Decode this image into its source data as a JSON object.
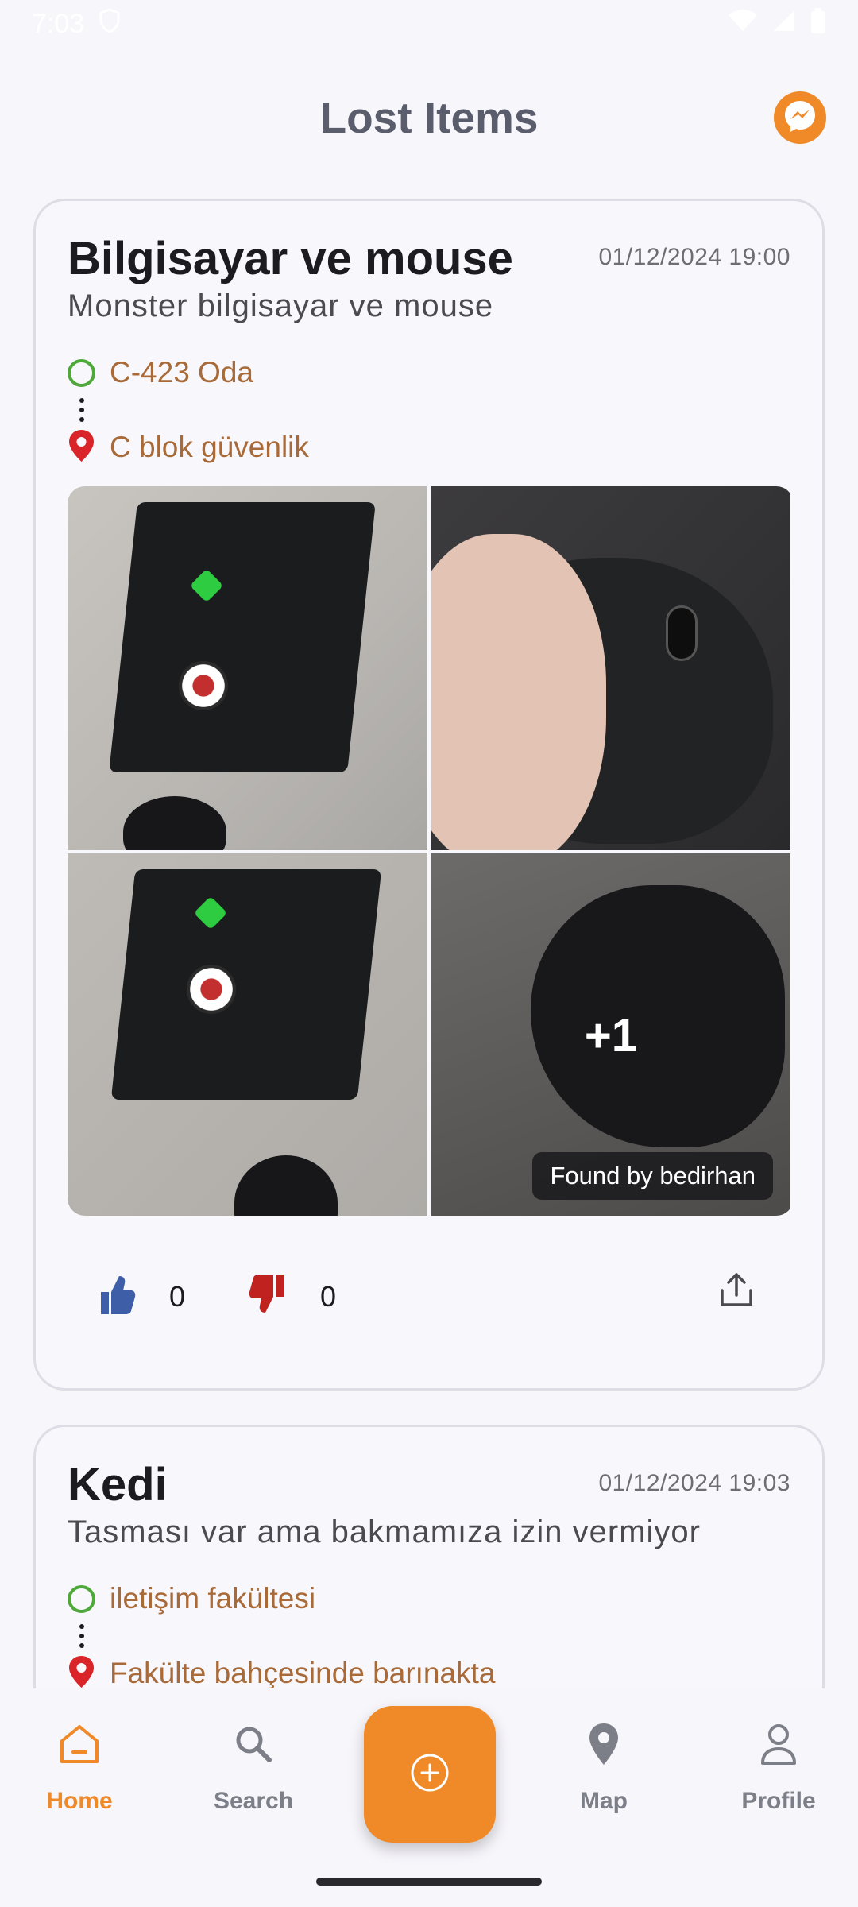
{
  "status_bar": {
    "time": "7:03"
  },
  "header": {
    "title": "Lost Items",
    "messenger_icon": "messenger-icon"
  },
  "colors": {
    "accent": "#f08a29",
    "route_text": "#a86a38",
    "origin": "#4ea83a",
    "destination": "#d9252a",
    "like": "#3f5ea8",
    "dislike": "#c0231f"
  },
  "items": [
    {
      "title": "Bilgisayar ve mouse",
      "date": "01/12/2024 19:00",
      "description": "Monster bilgisayar ve mouse",
      "from": "C-423 Oda",
      "to": "C blok güvenlik",
      "extra_photos": "+1",
      "found_by": "Found by bedirhan",
      "likes": "0",
      "dislikes": "0"
    },
    {
      "title": "Kedi",
      "date": "01/12/2024 19:03",
      "description": "Tasması var ama bakmamıza izin vermiyor",
      "from": "iletişim fakültesi",
      "to": "Fakülte bahçesinde barınakta"
    }
  ],
  "nav": {
    "home": "Home",
    "search": "Search",
    "map": "Map",
    "profile": "Profile",
    "active": "home"
  }
}
